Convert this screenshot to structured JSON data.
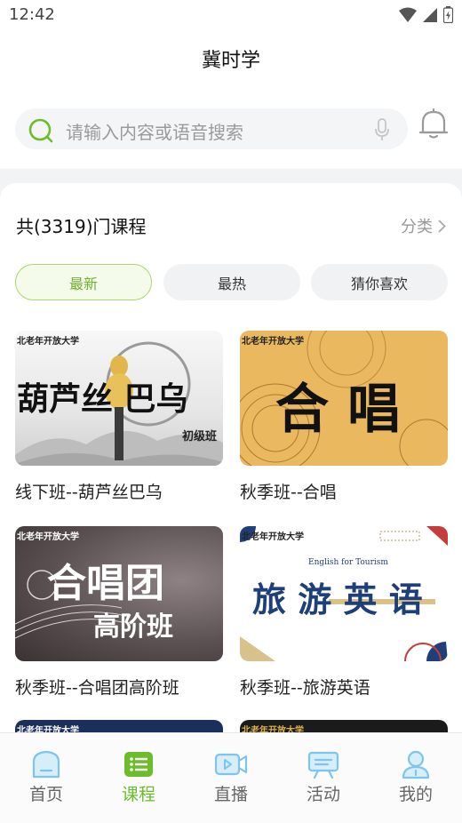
{
  "status_bar": {
    "time": "12:42"
  },
  "header": {
    "title": "冀时学"
  },
  "search": {
    "placeholder": "请输入内容或语音搜索"
  },
  "section": {
    "course_count": "共(3319)门课程",
    "category_label": "分类"
  },
  "filters": [
    {
      "label": "最新",
      "active": true
    },
    {
      "label": "最热",
      "active": false
    },
    {
      "label": "猜你喜欢",
      "active": false
    }
  ],
  "courses": [
    {
      "title": "线下班--葫芦丝巴乌",
      "cover_text": "葫芦丝 巴乌",
      "cover_sub": "初级班",
      "brand": "北老年开放大学"
    },
    {
      "title": "秋季班--合唱",
      "cover_text": "合 唱",
      "brand": "北老年开放大学"
    },
    {
      "title": "秋季班--合唱团高阶班",
      "cover_text": "合唱团",
      "cover_sub": "高阶班",
      "brand": "北老年开放大学"
    },
    {
      "title": "秋季班--旅游英语",
      "cover_text": "旅 游 英 语",
      "cover_sub": "English for Tourism",
      "brand": "北老年开放大学"
    }
  ],
  "partial_cards": [
    {
      "brand": "北老年开放大学"
    },
    {
      "brand": "北老年开放大学"
    }
  ],
  "bottom_nav": [
    {
      "label": "首页",
      "icon": "home-icon",
      "active": false
    },
    {
      "label": "课程",
      "icon": "course-list-icon",
      "active": true
    },
    {
      "label": "直播",
      "icon": "live-icon",
      "active": false
    },
    {
      "label": "活动",
      "icon": "activity-icon",
      "active": false
    },
    {
      "label": "我的",
      "icon": "profile-icon",
      "active": false
    }
  ],
  "colors": {
    "accent": "#6cbc2c",
    "icon_blue": "#7fc4ea",
    "muted": "#999999"
  }
}
